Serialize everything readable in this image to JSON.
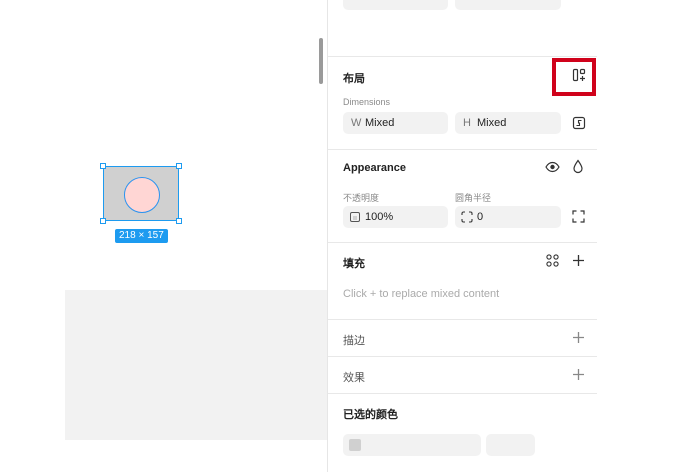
{
  "canvas": {
    "selection_size_label": "218 × 157"
  },
  "layout_section": {
    "title": "布局",
    "dimensions_label": "Dimensions",
    "width": {
      "prefix": "W",
      "value": "Mixed"
    },
    "height": {
      "prefix": "H",
      "value": "Mixed"
    }
  },
  "appearance_section": {
    "title": "Appearance",
    "opacity_label": "不透明度",
    "opacity_value": "100%",
    "radius_label": "圆角半径",
    "radius_value": "0"
  },
  "fill_section": {
    "title": "填充",
    "placeholder": "Click + to replace mixed content"
  },
  "stroke_section": {
    "title": "描边"
  },
  "effects_section": {
    "title": "效果"
  },
  "selected_colors_section": {
    "title": "已选的颜色"
  },
  "colors": {
    "selection_blue": "#1d9bf0",
    "highlight_red": "#d0021b",
    "circle_fill": "#ffd6d4",
    "frame_fill": "#d0d0d0"
  }
}
